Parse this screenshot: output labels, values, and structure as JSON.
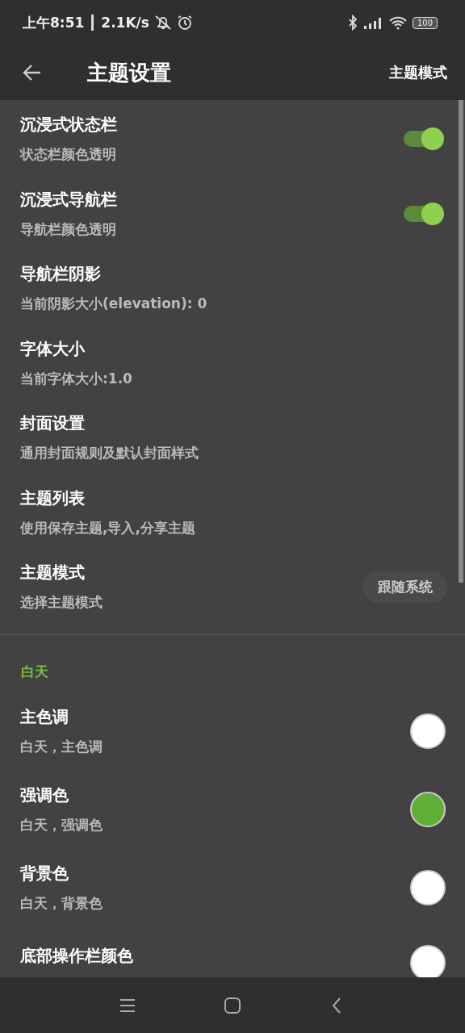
{
  "status_bar": {
    "time": "上午8:51",
    "speed": "2.1K/s",
    "battery": "100"
  },
  "header": {
    "title": "主题设置",
    "action": "主题模式"
  },
  "settings": [
    {
      "kind": "switch",
      "title": "沉浸式状态栏",
      "subtitle": "状态栏颜色透明",
      "on": true
    },
    {
      "kind": "switch",
      "title": "沉浸式导航栏",
      "subtitle": "导航栏颜色透明",
      "on": true
    },
    {
      "kind": "plain",
      "title": "导航栏阴影",
      "subtitle": "当前阴影大小(elevation): 0"
    },
    {
      "kind": "plain",
      "title": "字体大小",
      "subtitle": "当前字体大小:1.0"
    },
    {
      "kind": "plain",
      "title": "封面设置",
      "subtitle": "通用封面规则及默认封面样式"
    },
    {
      "kind": "plain",
      "title": "主题列表",
      "subtitle": "使用保存主题,导入,分享主题"
    },
    {
      "kind": "chip",
      "title": "主题模式",
      "subtitle": "选择主题模式",
      "value": "跟随系统"
    }
  ],
  "section": {
    "title": "白天"
  },
  "colors": [
    {
      "title": "主色调",
      "subtitle": "白天，主色调",
      "color": "#ffffff"
    },
    {
      "title": "强调色",
      "subtitle": "白天，强调色",
      "color": "#5fae35"
    },
    {
      "title": "背景色",
      "subtitle": "白天，背景色",
      "color": "#ffffff"
    },
    {
      "title": "底部操作栏颜色",
      "color": "#ffffff"
    }
  ]
}
